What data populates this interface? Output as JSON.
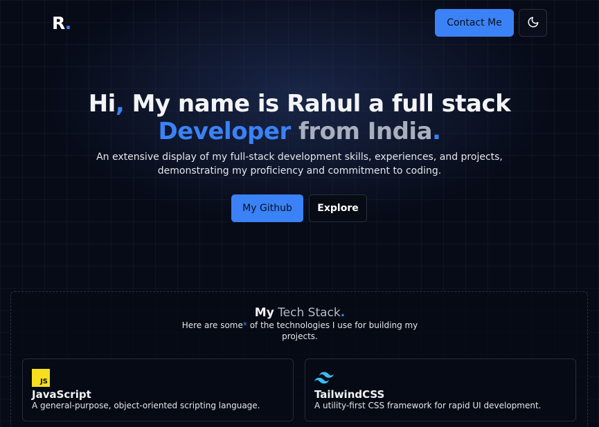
{
  "header": {
    "logo_letter": "R",
    "logo_dot": ".",
    "contact_label": "Contact Me",
    "theme_icon": "moon-icon"
  },
  "hero": {
    "title_hi": "Hi",
    "title_comma": ",",
    "title_rest_line1": " My name is Rahul a full stack",
    "title_developer": "Developer",
    "title_from": " from India",
    "title_period": ".",
    "subtitle_line1": "An extensive display of my full-stack development skills, experiences, and projects,",
    "subtitle_line2": "demonstrating my proficiency and commitment to coding.",
    "github_label": "My Github",
    "explore_label": "Explore"
  },
  "tech_stack": {
    "title_my": "My",
    "title_rest": " Tech Stack",
    "title_period": ".",
    "subtitle_part1": "Here are some",
    "subtitle_asterisk": "*",
    "subtitle_part2": " of the technologies I use for building my projects.",
    "items": [
      {
        "name": "JavaScript",
        "icon": "javascript-icon",
        "icon_text": "JS",
        "description": "A general-purpose, object-oriented scripting language."
      },
      {
        "name": "TailwindCSS",
        "icon": "tailwindcss-icon",
        "description": "A utility-first CSS framework for rapid UI development."
      }
    ]
  },
  "colors": {
    "accent": "#3b82f6",
    "background": "#070b18"
  }
}
